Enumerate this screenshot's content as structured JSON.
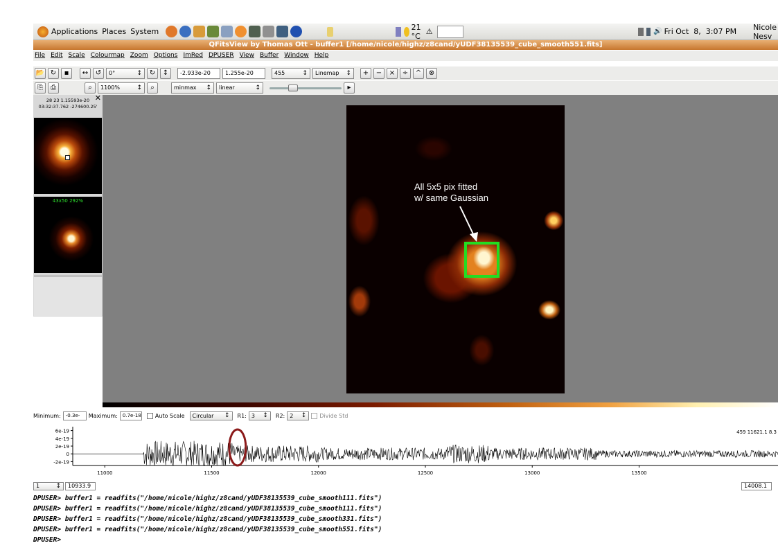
{
  "panel": {
    "menus": [
      "Applications",
      "Places",
      "System"
    ],
    "weather": "21 °C",
    "clock": "Fri Oct  8,  3:07 PM",
    "user": "Nicole Nesv"
  },
  "window": {
    "title": "QFitsView by Thomas Ott - buffer1 [/home/nicole/highz/z8cand/yUDF38135539_cube_smooth551.fits]"
  },
  "menubar": [
    "File",
    "Edit",
    "Scale",
    "Colourmap",
    "Zoom",
    "Options",
    "ImRed",
    "DPUSER",
    "View",
    "Buffer",
    "Window",
    "Help"
  ],
  "toolbar1": {
    "rotate_value": "0°",
    "min_value": "-2.933e-20",
    "max_value": "1.255e-20",
    "slice_value": "455",
    "colormap": "Linemap",
    "ops": [
      "+",
      "−",
      "×",
      "÷",
      "^",
      "⊗"
    ]
  },
  "toolbar2": {
    "zoom_value": "1100%",
    "scale_mode": "minmax",
    "scale_type": "linear",
    "slider_value": 0.3
  },
  "sidepanel": {
    "coords_line1": "28 23 1.15593e-20",
    "coords_line2": "03:32:37.762 -274600.25'",
    "thumb2_label": "43x50  292%"
  },
  "annotation": {
    "line1": "All 5x5 pix fitted",
    "line2": "w/ same Gaussian"
  },
  "controls": {
    "minimum_label": "Minimum:",
    "minimum_value": "-0.3e-18",
    "maximum_label": "Maximum:",
    "maximum_value": "0.7e-18",
    "autoscale_label": "Auto Scale",
    "shape": "Circular",
    "r1_label": "R1:",
    "r1_value": "3",
    "r2_label": "R2:",
    "r2_value": "2",
    "divide_label": "Divide Std"
  },
  "chart_data": {
    "type": "line",
    "yticks": [
      "6e-19",
      "4e-19",
      "2e-19",
      "0",
      "-2e-19"
    ],
    "xticks": [
      11000,
      11500,
      12000,
      12500,
      13000,
      13500
    ],
    "xlim": [
      10850,
      14150
    ],
    "ylim": [
      -3e-19,
      7e-19
    ],
    "readout": "459 11621.1 8.3",
    "circled_x": 11621,
    "start_value": "1",
    "start_wave": "10933.9",
    "end_wave": "14008.1"
  },
  "console": [
    "DPUSER> buffer1 = readfits(\"/home/nicole/highz/z8cand/yUDF38135539_cube_smooth111.fits\")",
    "DPUSER> buffer1 = readfits(\"/home/nicole/highz/z8cand/yUDF38135539_cube_smooth111.fits\")",
    "DPUSER> buffer1 = readfits(\"/home/nicole/highz/z8cand/yUDF38135539_cube_smooth331.fits\")",
    "DPUSER> buffer1 = readfits(\"/home/nicole/highz/z8cand/yUDF38135539_cube_smooth551.fits\")",
    "DPUSER>"
  ],
  "colors": {
    "title_orange": "#c7772f",
    "fit_box": "#22dd22",
    "circle": "#8b1a1a"
  }
}
